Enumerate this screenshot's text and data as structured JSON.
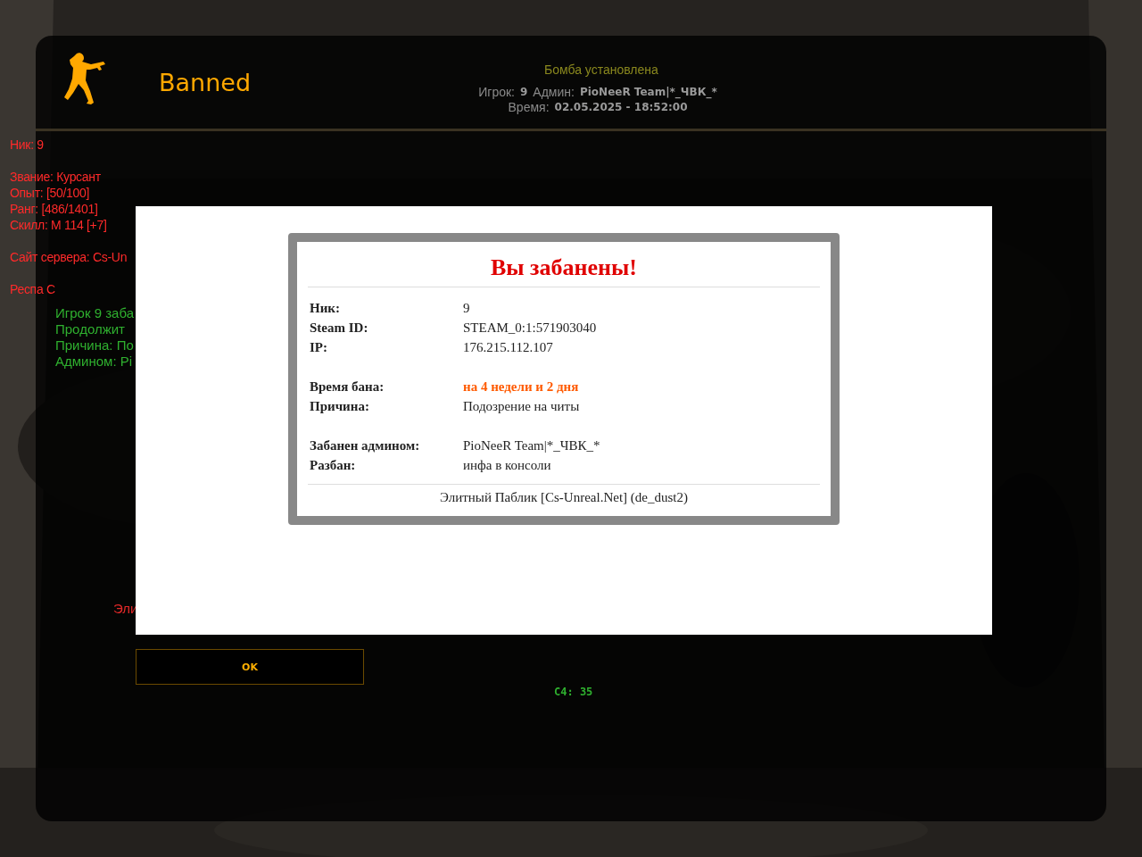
{
  "header": {
    "title": "Banned",
    "info": [
      {
        "label": "Игрок:",
        "value": "9"
      },
      {
        "label": "Админ:",
        "value": "PioNeeR Team|*_ЧВК_*"
      },
      {
        "label": "Время:",
        "value": "02.05.2025 - 18:52:00"
      }
    ],
    "notice": "Бомба установлена"
  },
  "hud_left": [
    [
      "Ник: 9"
    ],
    [
      "Звание: Курсант",
      "Опыт: [50/100]",
      "Ранг: [486/1401]",
      "Скилл: M 114 [+7]"
    ],
    [
      "Сайт сервера: Cs-Un"
    ],
    [
      "Респа С"
    ]
  ],
  "hud_messages": [
    "Игрок 9 заба",
    "Продолжит",
    "Причина: По",
    "Админом: Pi"
  ],
  "hud_bottom": "Эли",
  "hud_timer": "C4: 35",
  "dialog": {
    "title": "Вы забанены!",
    "groups": [
      [
        {
          "label": "Ник:",
          "value": "9",
          "kind": "plain"
        },
        {
          "label": "Steam ID:",
          "value": "STEAM_0:1:571903040",
          "kind": "plain"
        },
        {
          "label": "IP:",
          "value": "176.215.112.107",
          "kind": "plain"
        }
      ],
      [
        {
          "label": "Время бана:",
          "value": "на 4 недели и 2 дня",
          "kind": "highlight"
        },
        {
          "label": "Причина:",
          "value": "Подозрение на читы",
          "kind": "plain"
        }
      ],
      [
        {
          "label": "Забанен админом:",
          "value": "PioNeeR Team|*_ЧВК_*",
          "kind": "plain"
        },
        {
          "label": "Разбан:",
          "value": "инфа в консоли",
          "kind": "plain"
        }
      ]
    ],
    "footer": "Элитный Паблик [Cs-Unreal.Net] (de_dust2)"
  },
  "button": {
    "label": "OK"
  }
}
